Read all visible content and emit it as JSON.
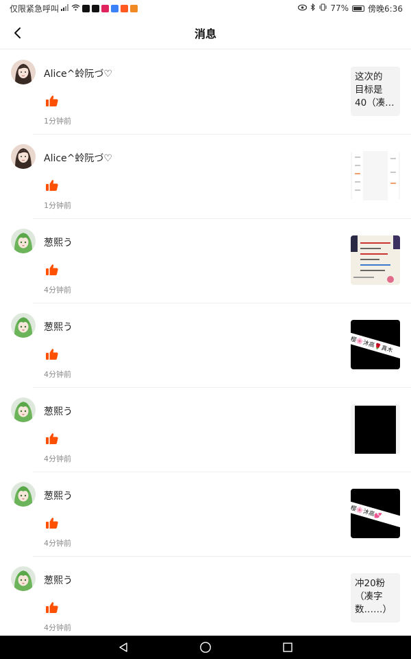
{
  "status_bar": {
    "carrier": "仅限紧急呼叫",
    "battery": "77%",
    "battery_level": 0.77,
    "time": "傍晚6:36",
    "app_icon_colors": [
      "#111111",
      "#111111",
      "#e0245e",
      "#3b82f6",
      "#ff5a1f",
      "#f08a24"
    ]
  },
  "header": {
    "title": "消息",
    "back_icon": "chevron-left-icon"
  },
  "like_color": "#ff5000",
  "messages": [
    {
      "user": "Alice^蛉阮づ♡",
      "time": "1分钟前",
      "avatar": "female-avatar",
      "thumb": {
        "kind": "text",
        "lines": [
          "这次的",
          "目标是",
          "40（凑…"
        ]
      }
    },
    {
      "user": "Alice^蛉阮づ♡",
      "time": "1分钟前",
      "avatar": "female-avatar",
      "thumb": {
        "kind": "screenshot",
        "lines": []
      }
    },
    {
      "user": "葱熙う",
      "time": "4分钟前",
      "avatar": "green-hair-avatar",
      "thumb": {
        "kind": "colorful",
        "lines": []
      }
    },
    {
      "user": "葱熙う",
      "time": "4分钟前",
      "avatar": "green-hair-avatar",
      "thumb": {
        "kind": "banner",
        "lines": [
          "暖樱🌸沐高🌹真木"
        ]
      }
    },
    {
      "user": "葱熙う",
      "time": "4分钟前",
      "avatar": "green-hair-avatar",
      "thumb": {
        "kind": "black",
        "lines": []
      }
    },
    {
      "user": "葱熙う",
      "time": "4分钟前",
      "avatar": "green-hair-avatar",
      "thumb": {
        "kind": "banner",
        "lines": [
          "暖樱🌸沐高💕"
        ]
      }
    },
    {
      "user": "葱熙う",
      "time": "4分钟前",
      "avatar": "green-hair-avatar",
      "thumb": {
        "kind": "text",
        "lines": [
          "冲20粉",
          "（凑字",
          "数……）"
        ]
      }
    }
  ],
  "nav": {
    "back": "triangle-back-icon",
    "home": "circle-home-icon",
    "recent": "square-recents-icon"
  }
}
